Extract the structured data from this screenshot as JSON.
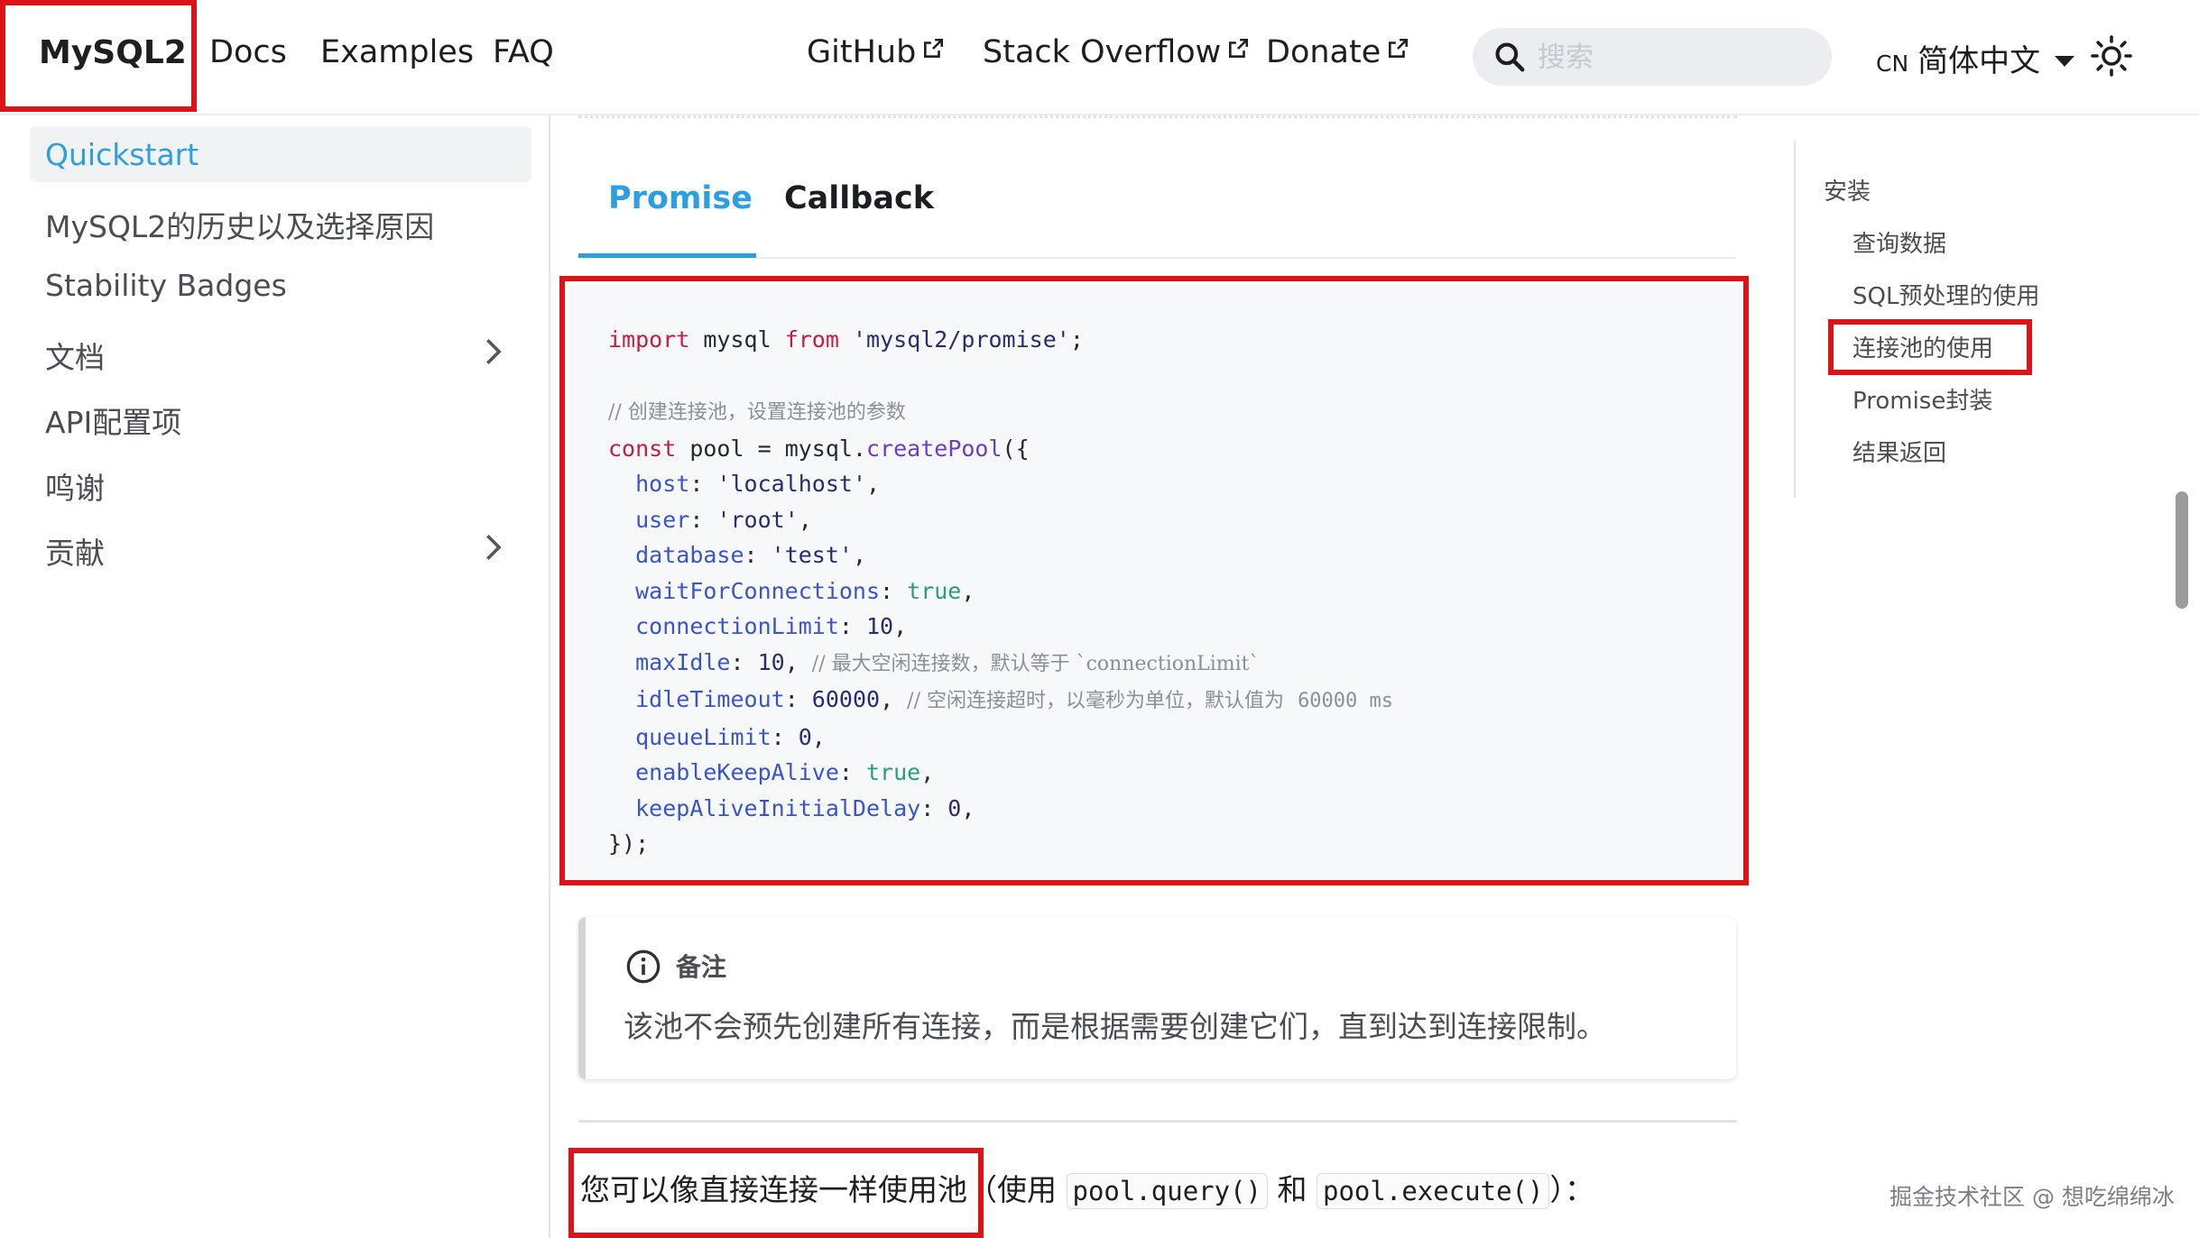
{
  "navbar": {
    "brand": "MySQL2",
    "left_links": [
      "Docs",
      "Examples",
      "FAQ"
    ],
    "external_links": [
      "GitHub",
      "Stack Overflow",
      "Donate"
    ],
    "search_placeholder": "搜索",
    "locale_code": "CN",
    "locale_label": "简体中文"
  },
  "sidebar": {
    "items": [
      {
        "label": "Quickstart",
        "active": true
      },
      {
        "label": "MySQL2的历史以及选择原因"
      },
      {
        "label": "Stability Badges"
      },
      {
        "label": "文档",
        "expandable": true
      },
      {
        "label": "API配置项"
      },
      {
        "label": "鸣谢"
      },
      {
        "label": "贡献",
        "expandable": true
      }
    ]
  },
  "main": {
    "tabs": [
      "Promise",
      "Callback"
    ],
    "active_tab": "Promise",
    "code": {
      "import_kw": "import",
      "import_name": "mysql",
      "from_kw": "from",
      "module": "'mysql2/promise'",
      "comment_pool": "// 创建连接池，设置连接池的参数",
      "const_kw": "const",
      "pool_name": "pool",
      "create_obj": "mysql.",
      "create_fn": "createPool",
      "host_key": "host",
      "host_val": "'localhost'",
      "user_key": "user",
      "user_val": "'root'",
      "db_key": "database",
      "db_val": "'test'",
      "wait_key": "waitForConnections",
      "wait_val": "true",
      "limit_key": "connectionLimit",
      "limit_val": "10",
      "maxidle_key": "maxIdle",
      "maxidle_val": "10",
      "maxidle_comment": "// 最大空闲连接数，默认等于 `connectionLimit`",
      "idle_key": "idleTimeout",
      "idle_val": "60000",
      "idle_comment_a": "// 空闲连接超时，以毫秒为单位，默认值为",
      "idle_comment_b": "60000 ms",
      "queue_key": "queueLimit",
      "queue_val": "0",
      "keepalive_key": "enableKeepAlive",
      "keepalive_val": "true",
      "keepdelay_key": "keepAliveInitialDelay",
      "keepdelay_val": "0",
      "close": "});"
    },
    "admonition": {
      "title": "备注",
      "text": "该池不会预先创建所有连接，而是根据需要创建它们，直到达到连接限制。"
    },
    "bottom": {
      "lead": "您可以像直接连接一样使用池",
      "paren_open": "（使用",
      "code1": "pool.query()",
      "and": "和",
      "code2": "pool.execute()",
      "paren_close": "）："
    }
  },
  "toc": {
    "items": [
      "安装",
      "查询数据",
      "SQL预处理的使用",
      "连接池的使用",
      "Promise封装",
      "结果返回"
    ]
  },
  "watermark": "掘金技术社区 @ 想吃绵绵冰",
  "colors": {
    "accent": "#2e9fde",
    "highlight": "#d9141b"
  }
}
